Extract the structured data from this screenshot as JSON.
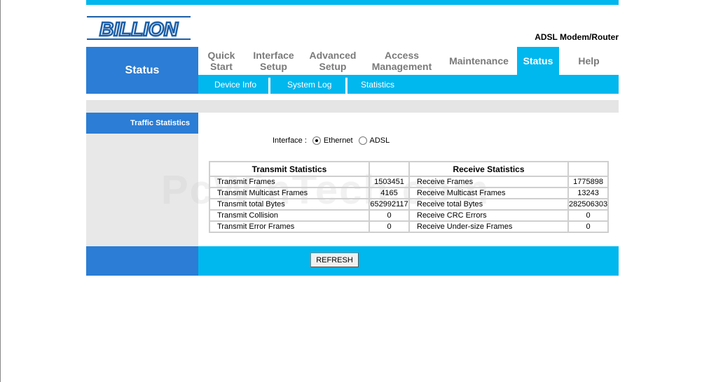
{
  "header": {
    "brand": "BILLION",
    "product": "ADSL Modem/Router"
  },
  "current_section": "Status",
  "main_nav": [
    {
      "label": "Quick\nStart"
    },
    {
      "label": "Interface\nSetup"
    },
    {
      "label": "Advanced\nSetup"
    },
    {
      "label": "Access\nManagement"
    },
    {
      "label": "Maintenance"
    },
    {
      "label": "Status",
      "active": true
    },
    {
      "label": "Help"
    }
  ],
  "sub_nav": [
    {
      "label": "Device Info"
    },
    {
      "label": "System Log"
    },
    {
      "label": "Statistics",
      "active": true
    }
  ],
  "sidebar_title": "Traffic Statistics",
  "interface": {
    "label": "Interface :",
    "options": [
      "Ethernet",
      "ADSL"
    ],
    "selected": "Ethernet"
  },
  "table": {
    "tx_header": "Transmit Statistics",
    "rx_header": "Receive Statistics",
    "rows": [
      {
        "tx_label": "Transmit Frames",
        "tx_value": "1503451",
        "rx_label": "Receive Frames",
        "rx_value": "1775898"
      },
      {
        "tx_label": "Transmit Multicast Frames",
        "tx_value": "4165",
        "rx_label": "Receive Multicast Frames",
        "rx_value": "13243"
      },
      {
        "tx_label": "Transmit total Bytes",
        "tx_value": "652992117",
        "rx_label": "Receive total Bytes",
        "rx_value": "282506303"
      },
      {
        "tx_label": "Transmit Collision",
        "tx_value": "0",
        "rx_label": "Receive CRC Errors",
        "rx_value": "0"
      },
      {
        "tx_label": "Transmit Error Frames",
        "tx_value": "0",
        "rx_label": "Receive Under-size Frames",
        "rx_value": "0"
      }
    ]
  },
  "refresh_label": "REFRESH",
  "watermark": "PcWinTech.com",
  "colors": {
    "accent": "#00b7ee",
    "panel_blue": "#2b7dd5",
    "nav_text": "#7a7a7a"
  }
}
